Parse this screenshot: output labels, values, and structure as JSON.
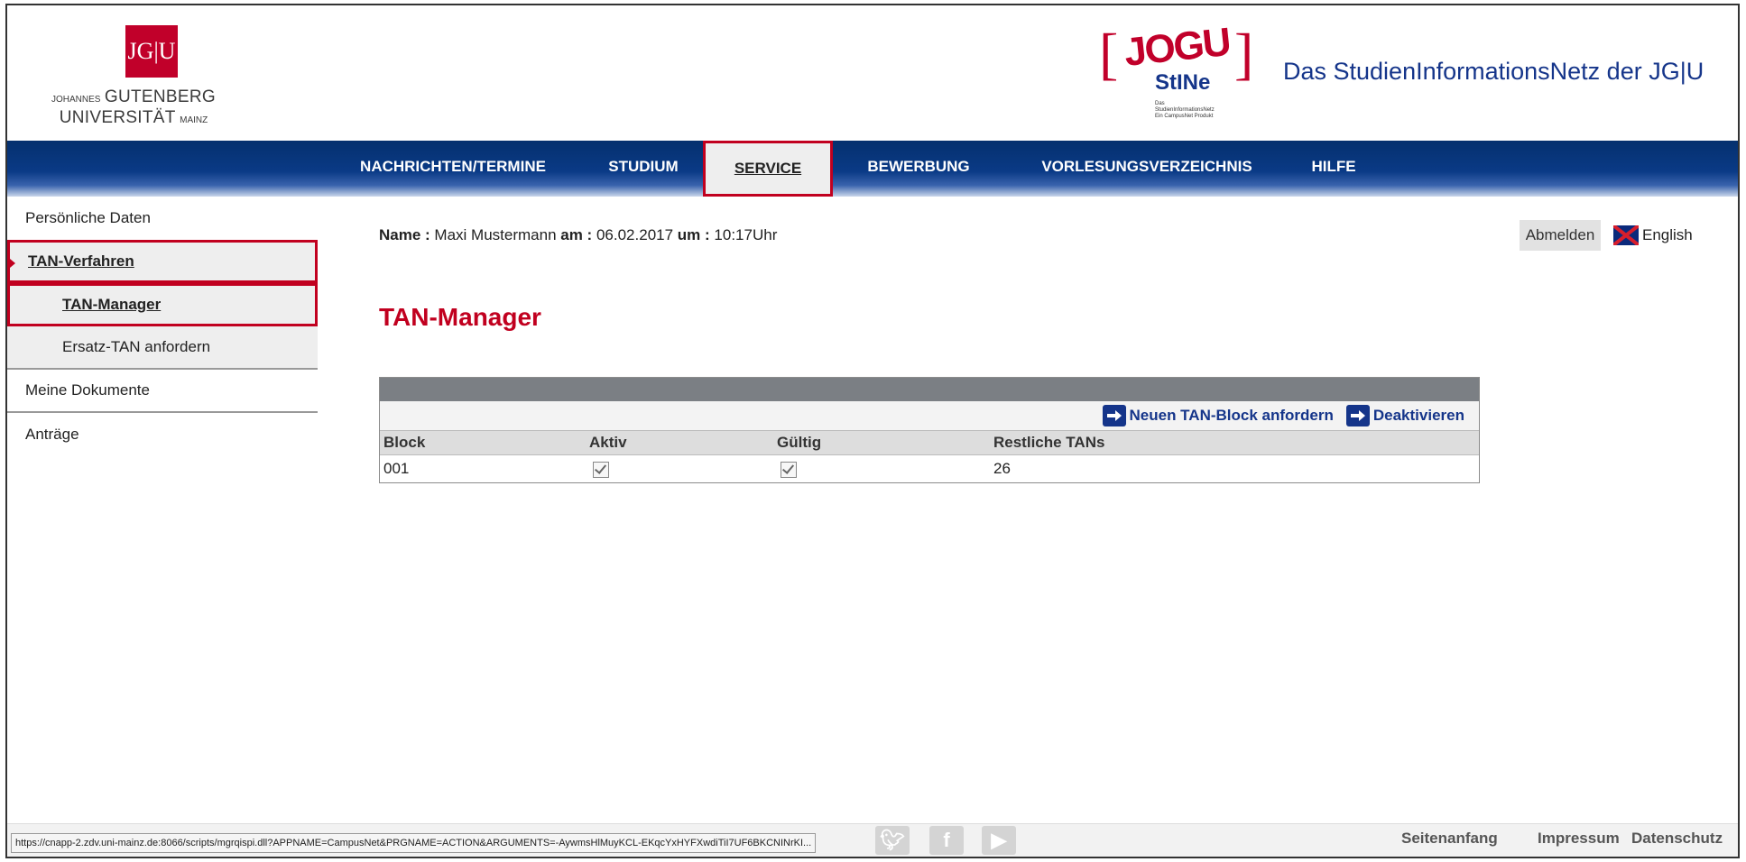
{
  "header": {
    "university_small": "JOHANNES",
    "university_line1": "GUTENBERG",
    "university_line2": "UNIVERSITÄT",
    "university_mainz": "MAINZ",
    "badge_text": "JG|U",
    "stine_top": "JOGU",
    "stine_bottom": "StINe",
    "stine_tiny": "Das StudienInformationsNetz Ein CampusNet Produkt",
    "site_title": "Das StudienInformationsNetz der JG|U"
  },
  "nav": {
    "items": [
      {
        "label": "NACHRICHTEN/TERMINE"
      },
      {
        "label": "STUDIUM"
      },
      {
        "label": "SERVICE",
        "active": true
      },
      {
        "label": "BEWERBUNG"
      },
      {
        "label": "VORLESUNGSVERZEICHNIS"
      },
      {
        "label": "HILFE"
      }
    ]
  },
  "sidebar": {
    "items": [
      {
        "label": "Persönliche Daten"
      },
      {
        "label": "TAN-Verfahren",
        "active": true
      },
      {
        "label": "TAN-Manager",
        "active": true
      },
      {
        "label": "Ersatz-TAN anfordern"
      },
      {
        "label": "Meine Dokumente"
      },
      {
        "label": "Anträge"
      }
    ]
  },
  "info": {
    "name_label": "Name :",
    "name_value": "Maxi Mustermann",
    "date_label": "am :",
    "date_value": "06.02.2017",
    "time_label": "um :",
    "time_value": "10:17Uhr"
  },
  "top_actions": {
    "logout": "Abmelden",
    "language": "English"
  },
  "page": {
    "title": "TAN-Manager"
  },
  "table": {
    "actions": [
      "Neuen TAN-Block anfordern",
      "Deaktivieren"
    ],
    "columns": [
      "Block",
      "Aktiv",
      "Gültig",
      "Restliche TANs"
    ],
    "rows": [
      {
        "block": "001",
        "aktiv": true,
        "gueltig": true,
        "restliche": "26"
      }
    ]
  },
  "footer": {
    "links": [
      "Seitenanfang",
      "Impressum",
      "Datenschutz"
    ],
    "status_url": "https://cnapp-2.zdv.uni-mainz.de:8066/scripts/mgrqispi.dll?APPNAME=CampusNet&PRGNAME=ACTION&ARGUMENTS=-AywmsHlMuyKCL-EKqcYxHYFXwdiTiI7UF6BKCNINrKI..."
  },
  "colors": {
    "brand_red": "#c1001f",
    "nav_blue": "#0a3a86",
    "link_blue": "#15358a"
  }
}
